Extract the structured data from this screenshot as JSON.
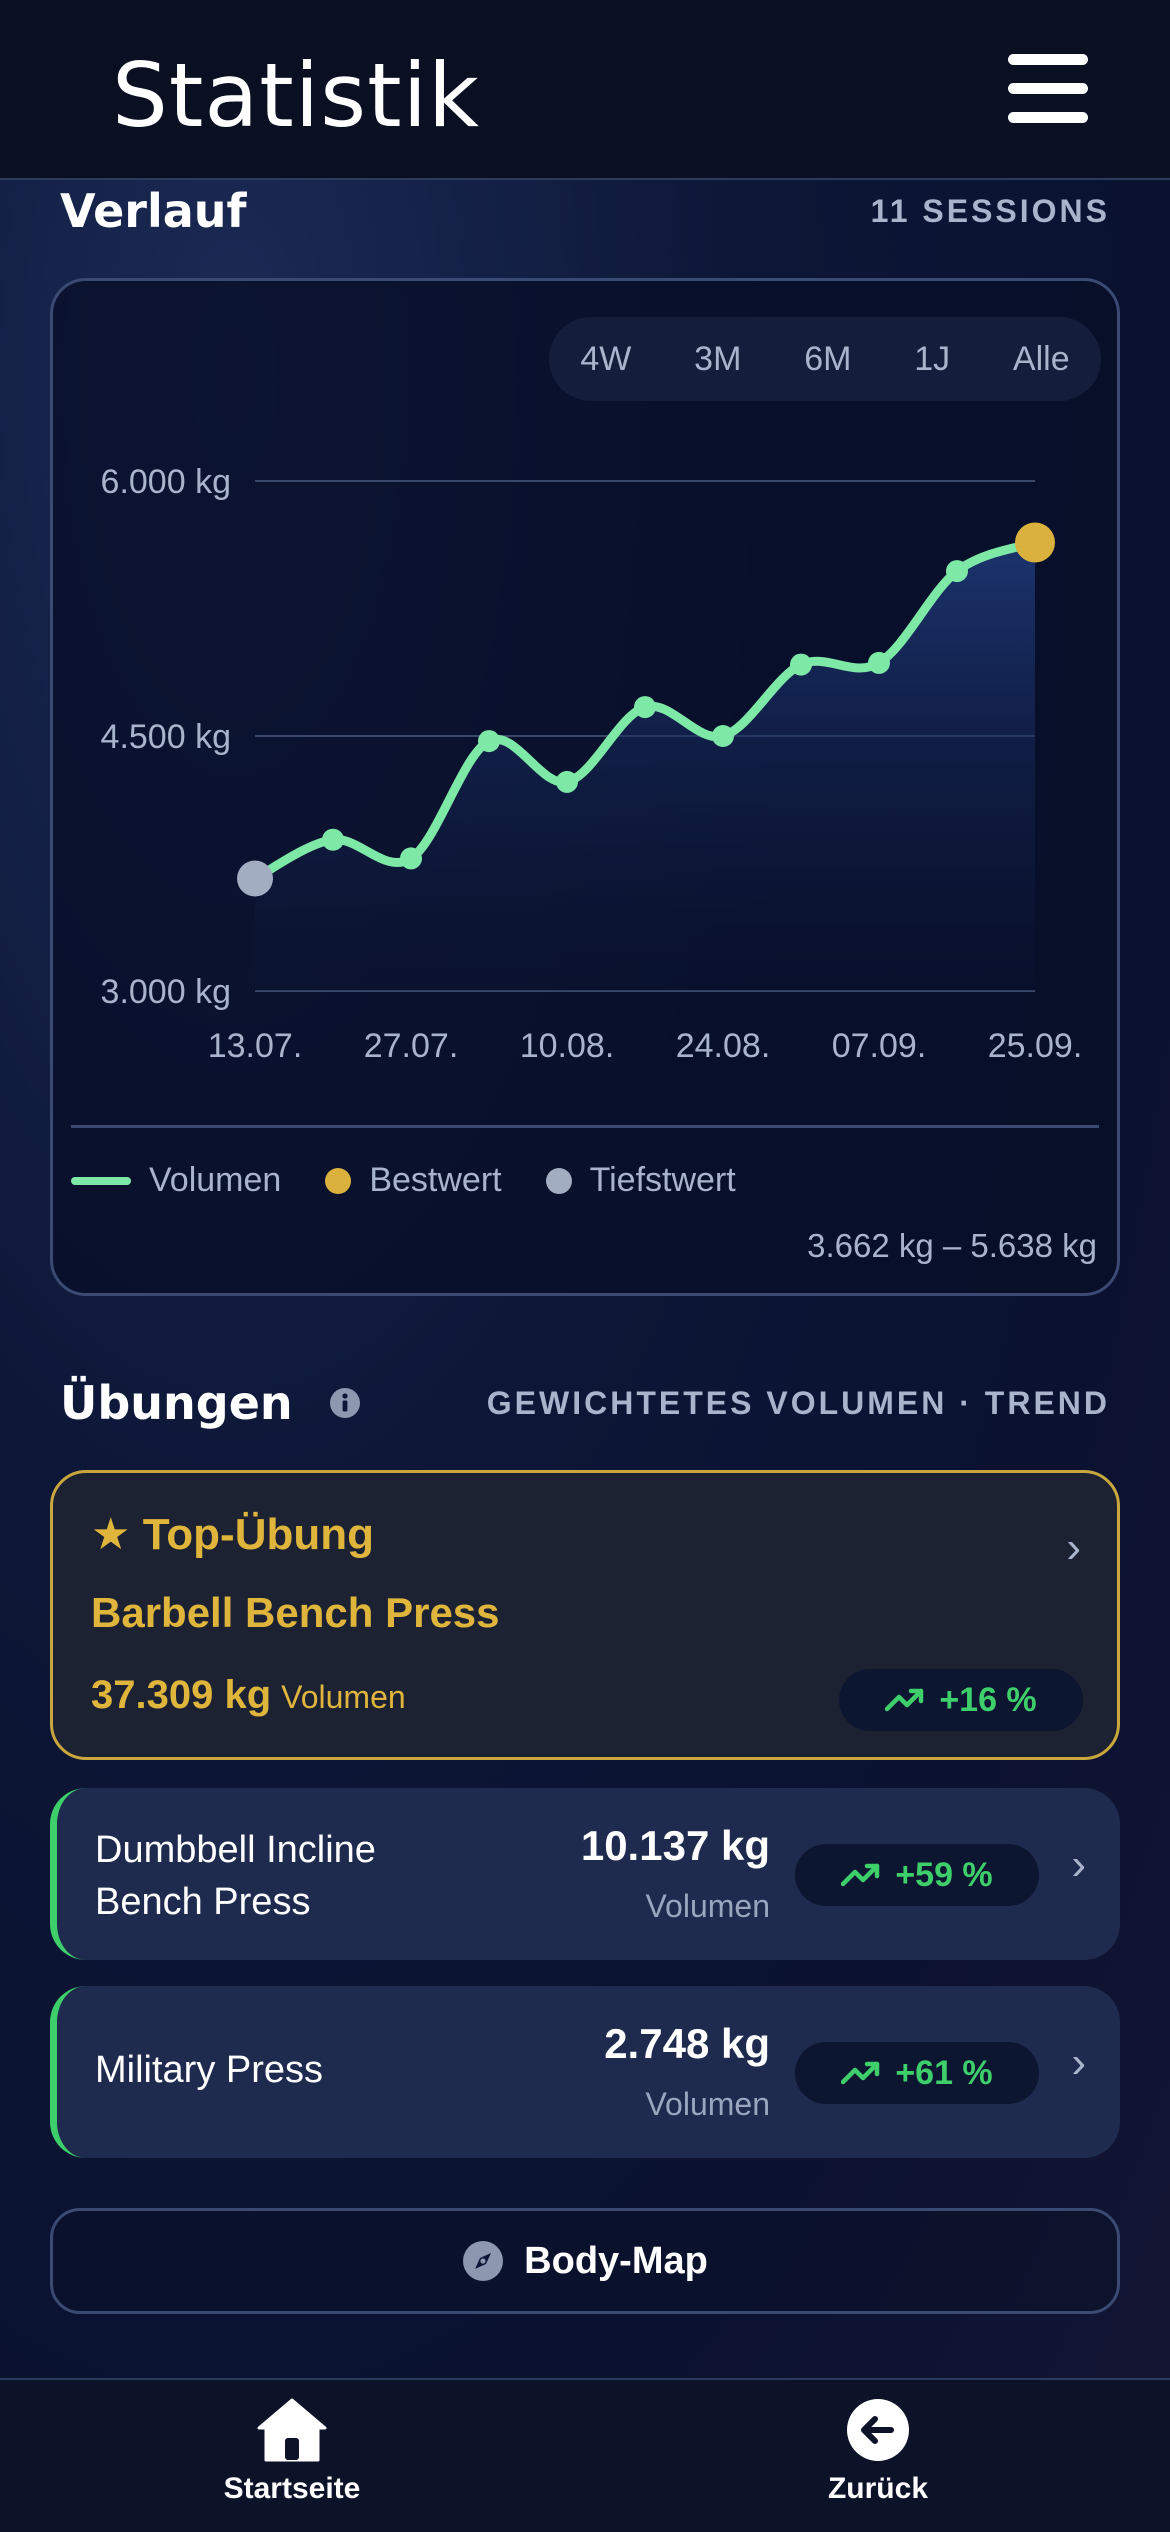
{
  "header": {
    "title": "Statistik"
  },
  "history": {
    "title": "Verlauf",
    "sessions": "11 SESSIONS",
    "ranges": [
      "4W",
      "3M",
      "6M",
      "1J",
      "Alle"
    ],
    "legend": {
      "volume": "Volumen",
      "best": "Bestwert",
      "lowest": "Tiefstwert"
    },
    "range_text": "3.662 kg – 5.638 kg"
  },
  "chart_data": {
    "type": "area",
    "ylim": [
      3000,
      6000
    ],
    "y_ticks": [
      "3.000 kg",
      "4.500 kg",
      "6.000 kg"
    ],
    "y_tick_values": [
      3000,
      4500,
      6000
    ],
    "x_tick_labels": [
      "13.07.",
      "27.07.",
      "10.08.",
      "24.08.",
      "07.09.",
      "25.09."
    ],
    "x_tick_index": [
      0,
      2,
      4,
      6,
      8,
      10
    ],
    "series": [
      {
        "name": "Volumen",
        "values": [
          3662,
          3890,
          3780,
          4470,
          4230,
          4670,
          4500,
          4920,
          4930,
          5470,
          5638
        ]
      }
    ],
    "min_index": 0,
    "max_index": 10,
    "colors": {
      "line": "#7ee8a6",
      "best": "#d9b13c",
      "lowest": "#a3adc2"
    }
  },
  "exercises": {
    "title": "Übungen",
    "subtitle": "GEWICHTETES VOLUMEN · TREND",
    "top": {
      "label": "Top-Übung",
      "name": "Barbell Bench Press",
      "value": "37.309 kg",
      "unit": "Volumen",
      "trend": "+16 %"
    },
    "items": [
      {
        "name_line1": "Dumbbell Incline",
        "name_line2": "Bench Press",
        "value": "10.137 kg",
        "unit": "Volumen",
        "trend": "+59 %"
      },
      {
        "name_line1": "Military Press",
        "name_line2": "",
        "value": "2.748 kg",
        "unit": "Volumen",
        "trend": "+61 %"
      }
    ]
  },
  "bodymap": {
    "label": "Body-Map"
  },
  "nav": {
    "home": "Startseite",
    "back": "Zurück"
  },
  "colors": {
    "accent_green": "#3ecf6b",
    "gold": "#e0b53c"
  }
}
